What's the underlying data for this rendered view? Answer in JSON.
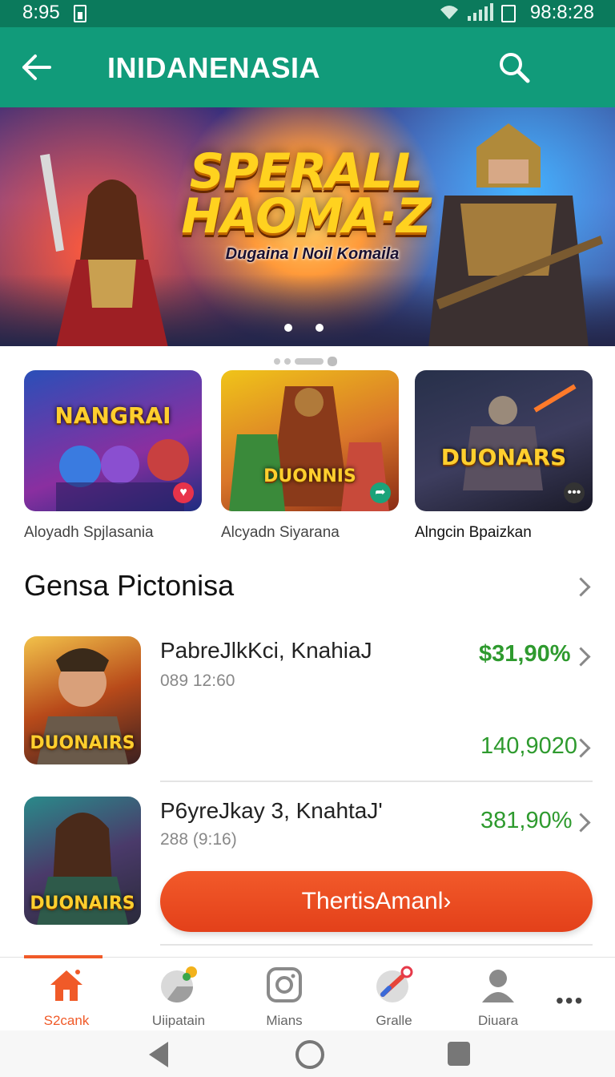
{
  "status_bar": {
    "time": "8:95",
    "right_text": "98:8:28"
  },
  "app_bar": {
    "title": "INIDANENASIA",
    "back_icon": "back-arrow-icon",
    "search_icon": "search-icon"
  },
  "hero": {
    "headline_line1": "SPERALL",
    "headline_line2": "HAOMA·Z",
    "subline": "Dugaina I Noil Komaila"
  },
  "featured": [
    {
      "logo": "NANGRAI",
      "label": "Aloyadh Spjlasania",
      "badge_icon": "heart-icon",
      "badge_color": "#e8334a"
    },
    {
      "logo": "DUONNIS",
      "label": "Alcyadn Siyarana",
      "badge_icon": "share-icon",
      "badge_color": "#1aa37a"
    },
    {
      "logo": "DUONARS",
      "label": "Alngcin Bpaizkan",
      "badge_icon": "more-icon",
      "badge_color": "#333333"
    }
  ],
  "section": {
    "title": "Gensa Pictonisa"
  },
  "list": [
    {
      "title": "PabreJlkKci, KnahiaJ",
      "meta": "089  12:60",
      "logo": "DUONAIRS",
      "price": "$31,90%",
      "price2": "140,9020"
    },
    {
      "title": "P6yreJkay 3, KnahtaJ'",
      "meta": "288  (9:16)",
      "logo": "DUONAIRS",
      "price": "381,90%"
    }
  ],
  "cta": {
    "label": "ThertisAmanl›"
  },
  "bottom_nav": [
    {
      "label": "S2cank",
      "icon": "home-icon",
      "active": true
    },
    {
      "label": "Uiipatain",
      "icon": "chart-icon",
      "active": false
    },
    {
      "label": "Mians",
      "icon": "instagram-icon",
      "active": false
    },
    {
      "label": "Gralle",
      "icon": "tools-icon",
      "active": false
    },
    {
      "label": "Diuara",
      "icon": "profile-icon",
      "active": false
    }
  ],
  "more_label": "•••",
  "colors": {
    "app_bar": "#119b7a",
    "status_bar": "#0b7a5c",
    "accent": "#f05a28",
    "price": "#2e9a2e"
  }
}
